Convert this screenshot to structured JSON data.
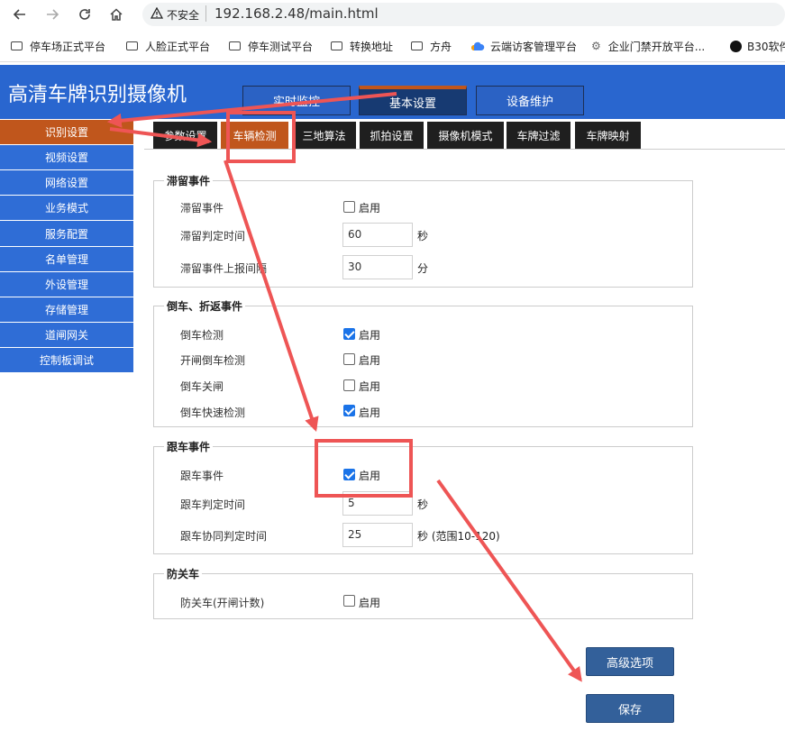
{
  "browser": {
    "security_label": "不安全",
    "url": "192.168.2.48/main.html",
    "bookmarks": [
      "停车场正式平台",
      "人脸正式平台",
      "停车测试平台",
      "转换地址",
      "方舟",
      "云端访客管理平台",
      "企业门禁开放平台...",
      "B30软件"
    ]
  },
  "app": {
    "title": "高清车牌识别摄像机",
    "top_tabs": [
      "实时监控",
      "基本设置",
      "设备维护"
    ],
    "active_top_tab": "基本设置"
  },
  "sidebar": {
    "items": [
      "识别设置",
      "视频设置",
      "网络设置",
      "业务模式",
      "服务配置",
      "名单管理",
      "外设管理",
      "存储管理",
      "道闸网关",
      "控制板调试"
    ],
    "active": "识别设置"
  },
  "subtabs": {
    "items": [
      "参数设置",
      "车辆检测",
      "三地算法",
      "抓拍设置",
      "摄像机模式",
      "车牌过滤",
      "车牌映射"
    ],
    "active": "车辆检测"
  },
  "sections": {
    "stay": {
      "legend": "滞留事件",
      "event_label": "滞留事件",
      "enable_text": "启用",
      "enabled": false,
      "time_label": "滞留判定时间",
      "time_value": "60",
      "time_unit": "秒",
      "interval_label": "滞留事件上报间隔",
      "interval_value": "30",
      "interval_unit": "分"
    },
    "reverse": {
      "legend": "倒车、折返事件",
      "rows": [
        {
          "label": "倒车检测",
          "enable_text": "启用",
          "checked": true
        },
        {
          "label": "开闸倒车检测",
          "enable_text": "启用",
          "checked": false
        },
        {
          "label": "倒车关闸",
          "enable_text": "启用",
          "checked": false
        },
        {
          "label": "倒车快速检测",
          "enable_text": "启用",
          "checked": true
        }
      ]
    },
    "follow": {
      "legend": "跟车事件",
      "event_label": "跟车事件",
      "enable_text": "启用",
      "enabled": true,
      "time_label": "跟车判定时间",
      "time_value": "5",
      "time_unit": "秒",
      "coop_label": "跟车协同判定时间",
      "coop_value": "25",
      "coop_unit": "秒 (范围10-120)"
    },
    "anti": {
      "legend": "防关车",
      "label": "防关车(开闸计数)",
      "enable_text": "启用",
      "enabled": false
    }
  },
  "buttons": {
    "advanced": "高级选项",
    "save": "保存"
  },
  "annotation_color": "#ee5555"
}
